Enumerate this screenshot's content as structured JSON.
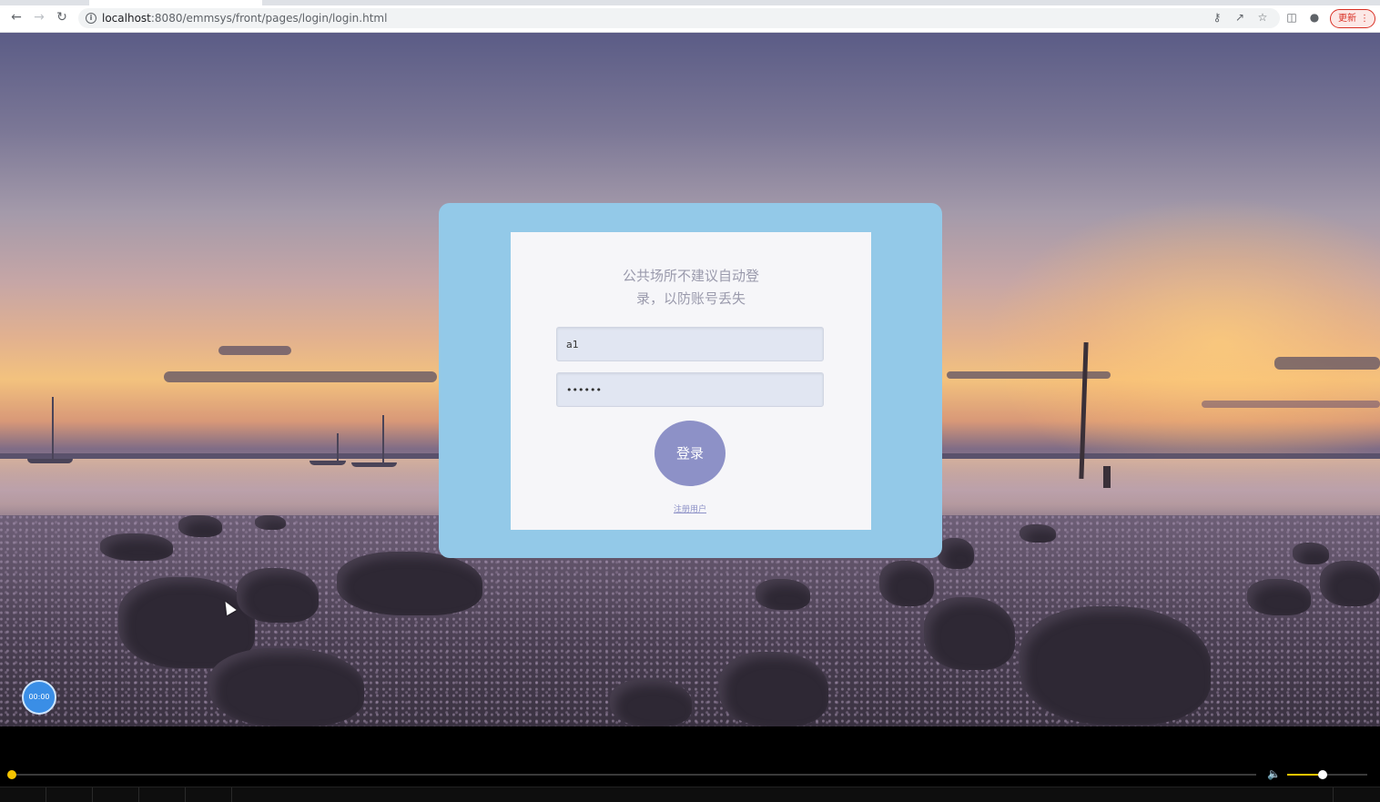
{
  "browser": {
    "url_host": "localhost",
    "url_rest": ":8080/emmsys/front/pages/login/login.html",
    "update_label": "更新",
    "update_menu": "⋮"
  },
  "login": {
    "notice_line1": "公共场所不建议自动登",
    "notice_line2": "录，以防账号丢失",
    "username_value": "a1",
    "password_value": "123456",
    "submit_label": "登录",
    "register_label": "注册用户"
  },
  "float_button": {
    "label": "00:00"
  },
  "player": {
    "progress": 0.0,
    "volume": 0.44
  }
}
